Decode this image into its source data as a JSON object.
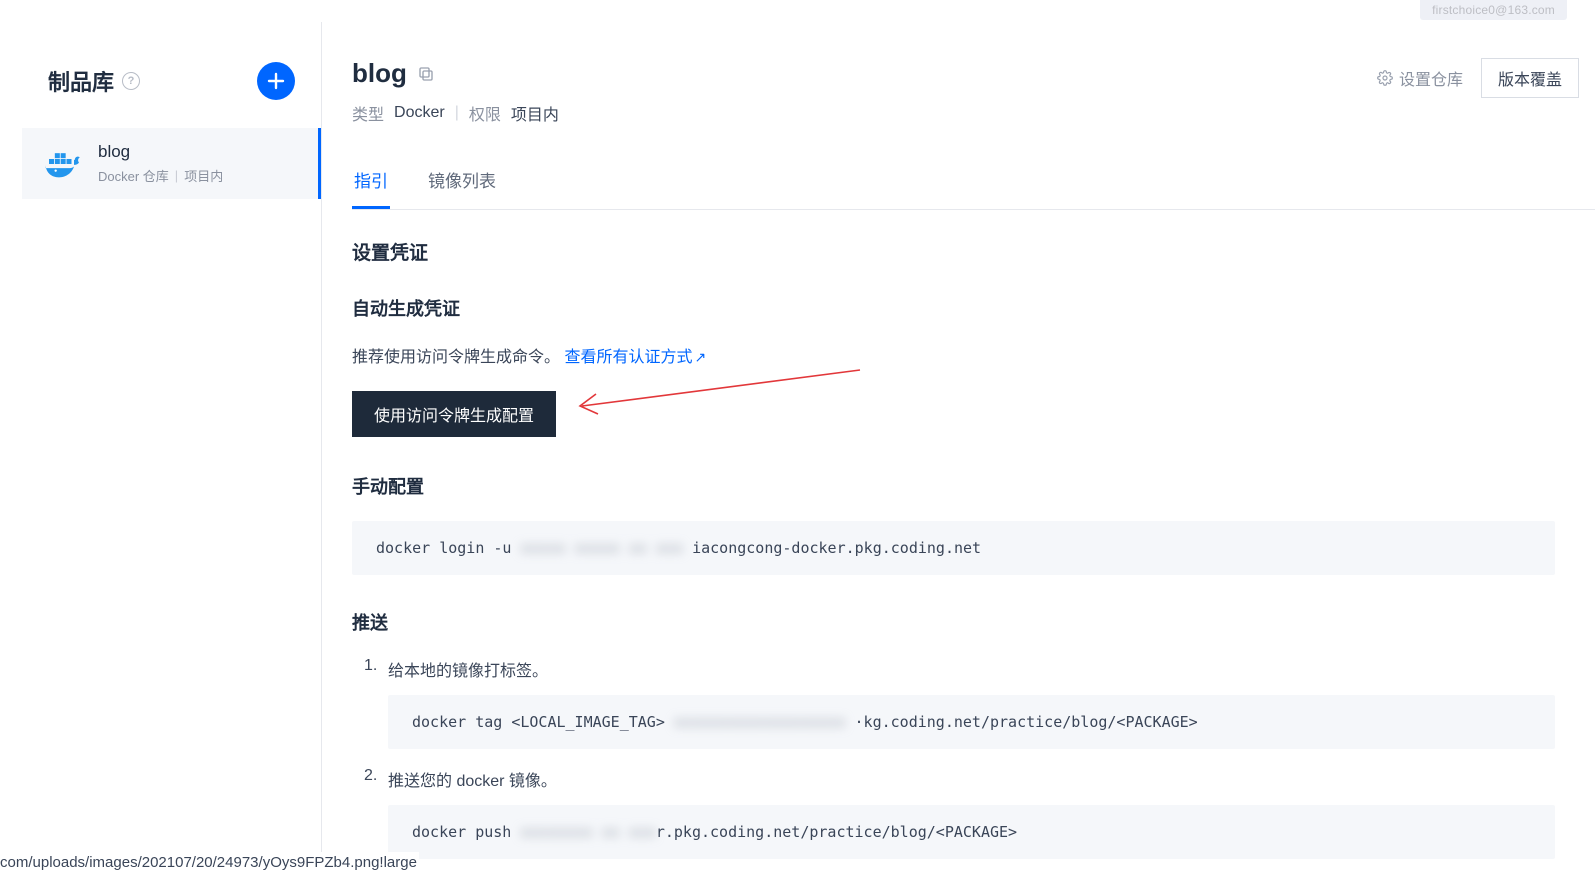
{
  "top_user": "firstchoice0@163.com",
  "sidebar": {
    "title": "制品库",
    "help_tooltip": "?",
    "items": [
      {
        "name": "blog",
        "type": "Docker 仓库",
        "scope": "项目内"
      }
    ]
  },
  "header": {
    "title": "blog",
    "meta": {
      "type_label": "类型",
      "type_value": "Docker",
      "perm_label": "权限",
      "perm_value": "项目内"
    },
    "settings_label": "设置仓库",
    "version_button": "版本覆盖"
  },
  "tabs": [
    {
      "label": "指引",
      "active": true
    },
    {
      "label": "镜像列表",
      "active": false
    }
  ],
  "guide": {
    "section_credentials_title": "设置凭证",
    "auto_title": "自动生成凭证",
    "auto_desc": "推荐使用访问令牌生成命令。",
    "auto_link": "查看所有认证方式",
    "generate_button": "使用访问令牌生成配置",
    "manual_title": "手动配置",
    "login_cmd_prefix": "docker login -u",
    "login_cmd_blurred": " xxxxx xxxxx xx xxx ",
    "login_cmd_suffix": "iacongcong-docker.pkg.coding.net",
    "push_title": "推送",
    "steps": [
      {
        "num": "1.",
        "text": "给本地的镜像打标签。",
        "cmd_prefix": "docker tag <LOCAL_IMAGE_TAG> ",
        "cmd_blurred": "xxxxxxxxxxxxxxxxxxx ",
        "cmd_suffix": "·kg.coding.net/practice/blog/<PACKAGE>"
      },
      {
        "num": "2.",
        "text": "推送您的 docker 镜像。",
        "cmd_prefix": "docker push ",
        "cmd_blurred": "xxxxxxxx xx xxx",
        "cmd_suffix": "r.pkg.coding.net/practice/blog/<PACKAGE>"
      }
    ]
  },
  "status_bar": "com/uploads/images/202107/20/24973/yOys9FPZb4.png!large"
}
